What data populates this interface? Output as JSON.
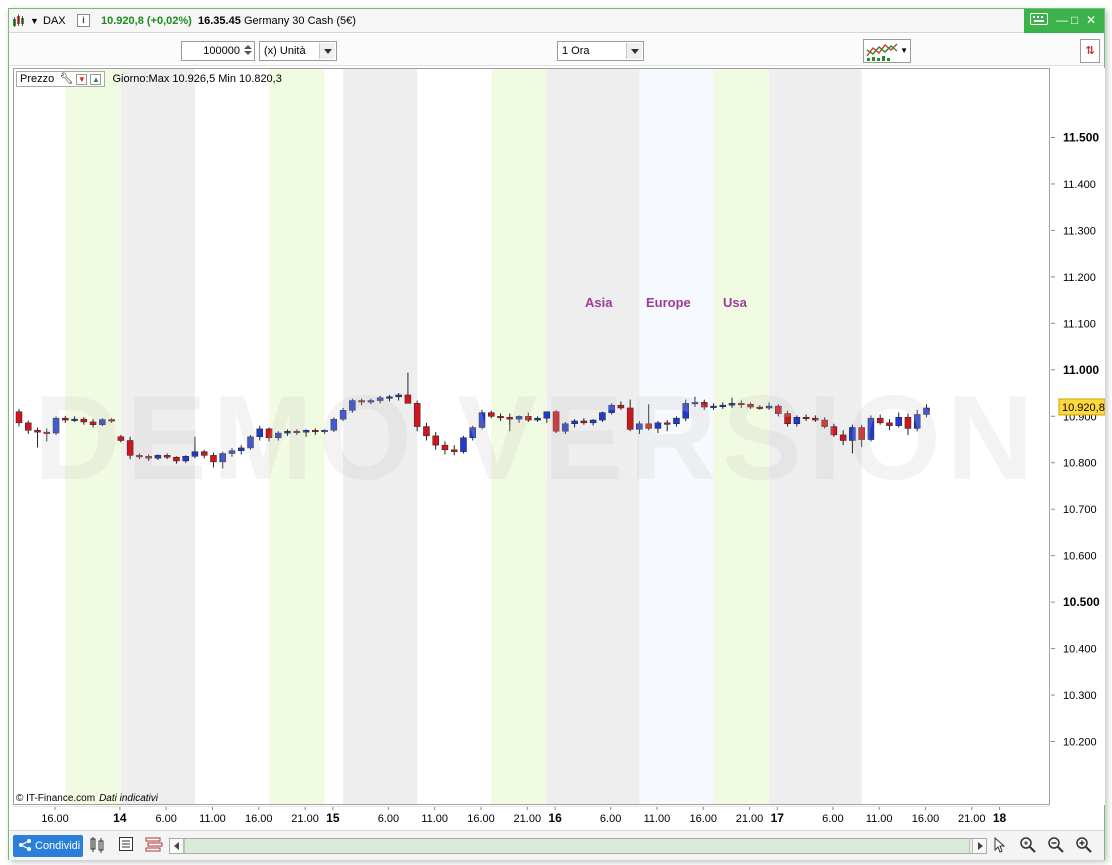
{
  "title_bar": {
    "symbol": "DAX",
    "info_icon": "i",
    "last_price": "10.920,8 (+0,02%)",
    "time": "16.35.45",
    "instrument": "Germany 30 Cash (5€)",
    "accent_color": "#3cb34a"
  },
  "toolbar": {
    "quantity": "100000",
    "unit_select": "(x) Unità",
    "timeframe_select": "1 Ora"
  },
  "chart": {
    "legend_label": "Prezzo",
    "legend_info": "Giorno:Max 10.926,5 Min 10.820,3",
    "watermark": "DEMO VERSION",
    "credit": "© IT-Finance.com",
    "credit_note": "Dati indicativi",
    "session_labels": [
      "Asia",
      "Europe",
      "Usa"
    ],
    "session_label_color": "#9b3c9b",
    "up_color": "#1f3bcf",
    "down_color": "#d0161c",
    "current_price_label": "10.920,8"
  },
  "chart_data": {
    "type": "candlestick",
    "ylim": [
      10100,
      11600
    ],
    "y_ticks": [
      {
        "value": 11500,
        "label": "11.500",
        "bold": true
      },
      {
        "value": 11400,
        "label": "11.400",
        "bold": false
      },
      {
        "value": 11300,
        "label": "11.300",
        "bold": false
      },
      {
        "value": 11200,
        "label": "11.200",
        "bold": false
      },
      {
        "value": 11100,
        "label": "11.100",
        "bold": false
      },
      {
        "value": 11000,
        "label": "11.000",
        "bold": true
      },
      {
        "value": 10900,
        "label": "10.900",
        "bold": false
      },
      {
        "value": 10800,
        "label": "10.800",
        "bold": false
      },
      {
        "value": 10700,
        "label": "10.700",
        "bold": false
      },
      {
        "value": 10600,
        "label": "10.600",
        "bold": false
      },
      {
        "value": 10500,
        "label": "10.500",
        "bold": true
      },
      {
        "value": 10400,
        "label": "10.400",
        "bold": false
      },
      {
        "value": 10300,
        "label": "10.300",
        "bold": false
      },
      {
        "value": 10200,
        "label": "10.200",
        "bold": false
      }
    ],
    "x_ticks": [
      {
        "bar": 4,
        "label": "16.00",
        "bold": false
      },
      {
        "bar": 11,
        "label": "14",
        "bold": true
      },
      {
        "bar": 16,
        "label": "6.00",
        "bold": false
      },
      {
        "bar": 21,
        "label": "11.00",
        "bold": false
      },
      {
        "bar": 26,
        "label": "16.00",
        "bold": false
      },
      {
        "bar": 31,
        "label": "21.00",
        "bold": false
      },
      {
        "bar": 34,
        "label": "15",
        "bold": true
      },
      {
        "bar": 40,
        "label": "6.00",
        "bold": false
      },
      {
        "bar": 45,
        "label": "11.00",
        "bold": false
      },
      {
        "bar": 50,
        "label": "16.00",
        "bold": false
      },
      {
        "bar": 55,
        "label": "21.00",
        "bold": false
      },
      {
        "bar": 58,
        "label": "16",
        "bold": true
      },
      {
        "bar": 64,
        "label": "6.00",
        "bold": false
      },
      {
        "bar": 69,
        "label": "11.00",
        "bold": false
      },
      {
        "bar": 74,
        "label": "16.00",
        "bold": false
      },
      {
        "bar": 79,
        "label": "21.00",
        "bold": false
      },
      {
        "bar": 82,
        "label": "17",
        "bold": true
      },
      {
        "bar": 88,
        "label": "6.00",
        "bold": false
      },
      {
        "bar": 93,
        "label": "11.00",
        "bold": false
      },
      {
        "bar": 98,
        "label": "16.00",
        "bold": false
      },
      {
        "bar": 103,
        "label": "21.00",
        "bold": false
      },
      {
        "bar": 106,
        "label": "18",
        "bold": true
      }
    ],
    "sessions": [
      {
        "name": "Asia",
        "from": 11,
        "to": 19,
        "color": "#eeeeee"
      },
      {
        "name": "Europe",
        "from": 5,
        "to": 11,
        "color": "#f1fbe2"
      },
      {
        "name": "Asia",
        "from": 35,
        "to": 43,
        "color": "#eeeeee"
      },
      {
        "name": "Europe",
        "from": 27,
        "to": 33,
        "color": "#f1fbe2"
      },
      {
        "name": "Europe",
        "from": 51,
        "to": 57,
        "color": "#f1fbe2"
      },
      {
        "name": "Asia",
        "from": 57,
        "to": 67,
        "color": "#eeeeee"
      },
      {
        "name": "Europe",
        "from": 67,
        "to": 75,
        "color": "#f6f9fd"
      },
      {
        "name": "Usa",
        "from": 75,
        "to": 81,
        "color": "#f1fbe2"
      },
      {
        "name": "Asia",
        "from": 81,
        "to": 91,
        "color": "#eeeeee"
      }
    ],
    "candles": [
      [
        10912,
        10918,
        10880,
        10888
      ],
      [
        10888,
        10893,
        10864,
        10872
      ],
      [
        10872,
        10878,
        10835,
        10868
      ],
      [
        10868,
        10876,
        10848,
        10866
      ],
      [
        10866,
        10902,
        10862,
        10898
      ],
      [
        10898,
        10903,
        10888,
        10894
      ],
      [
        10894,
        10902,
        10890,
        10896
      ],
      [
        10896,
        10900,
        10884,
        10890
      ],
      [
        10890,
        10896,
        10878,
        10884
      ],
      [
        10884,
        10898,
        10881,
        10895
      ],
      [
        10895,
        10898,
        10888,
        10892
      ],
      [
        10858,
        10862,
        10846,
        10850
      ],
      [
        10850,
        10858,
        10810,
        10818
      ],
      [
        10818,
        10822,
        10810,
        10816
      ],
      [
        10816,
        10820,
        10806,
        10812
      ],
      [
        10812,
        10820,
        10808,
        10818
      ],
      [
        10818,
        10822,
        10810,
        10814
      ],
      [
        10814,
        10816,
        10800,
        10806
      ],
      [
        10806,
        10818,
        10802,
        10816
      ],
      [
        10816,
        10858,
        10812,
        10826
      ],
      [
        10826,
        10830,
        10812,
        10818
      ],
      [
        10818,
        10824,
        10792,
        10804
      ],
      [
        10804,
        10826,
        10790,
        10822
      ],
      [
        10822,
        10834,
        10815,
        10828
      ],
      [
        10828,
        10840,
        10820,
        10834
      ],
      [
        10834,
        10862,
        10830,
        10858
      ],
      [
        10858,
        10882,
        10850,
        10875
      ],
      [
        10875,
        10878,
        10848,
        10856
      ],
      [
        10856,
        10870,
        10850,
        10866
      ],
      [
        10866,
        10874,
        10860,
        10870
      ],
      [
        10870,
        10874,
        10862,
        10868
      ],
      [
        10868,
        10874,
        10858,
        10872
      ],
      [
        10872,
        10876,
        10862,
        10870
      ],
      [
        10870,
        10874,
        10864,
        10872
      ],
      [
        10872,
        10900,
        10868,
        10896
      ],
      [
        10896,
        10920,
        10892,
        10915
      ],
      [
        10915,
        10940,
        10910,
        10936
      ],
      [
        10936,
        10940,
        10926,
        10934
      ],
      [
        10934,
        10940,
        10928,
        10936
      ],
      [
        10936,
        10946,
        10930,
        10942
      ],
      [
        10942,
        10948,
        10934,
        10944
      ],
      [
        10944,
        10952,
        10936,
        10948
      ],
      [
        10948,
        10996,
        10930,
        10930
      ],
      [
        10930,
        10936,
        10870,
        10880
      ],
      [
        10880,
        10888,
        10850,
        10860
      ],
      [
        10860,
        10868,
        10830,
        10840
      ],
      [
        10840,
        10848,
        10820,
        10830
      ],
      [
        10830,
        10840,
        10818,
        10826
      ],
      [
        10826,
        10860,
        10822,
        10856
      ],
      [
        10856,
        10882,
        10850,
        10878
      ],
      [
        10878,
        10916,
        10874,
        10910
      ],
      [
        10910,
        10914,
        10898,
        10902
      ],
      [
        10902,
        10908,
        10892,
        10900
      ],
      [
        10900,
        10908,
        10870,
        10896
      ],
      [
        10896,
        10904,
        10888,
        10902
      ],
      [
        10902,
        10910,
        10890,
        10894
      ],
      [
        10894,
        10902,
        10890,
        10898
      ],
      [
        10898,
        10910,
        10888,
        10912
      ],
      [
        10912,
        10915,
        10866,
        10870
      ],
      [
        10870,
        10890,
        10864,
        10886
      ],
      [
        10886,
        10896,
        10878,
        10892
      ],
      [
        10892,
        10898,
        10884,
        10888
      ],
      [
        10888,
        10896,
        10882,
        10894
      ],
      [
        10894,
        10912,
        10890,
        10910
      ],
      [
        10910,
        10930,
        10906,
        10926
      ],
      [
        10926,
        10934,
        10916,
        10920
      ],
      [
        10920,
        10938,
        10870,
        10874
      ],
      [
        10874,
        10892,
        10864,
        10886
      ],
      [
        10886,
        10928,
        10872,
        10876
      ],
      [
        10876,
        10892,
        10866,
        10888
      ],
      [
        10888,
        10894,
        10870,
        10886
      ],
      [
        10886,
        10902,
        10880,
        10898
      ],
      [
        10898,
        10938,
        10892,
        10930
      ],
      [
        10930,
        10944,
        10922,
        10932
      ],
      [
        10932,
        10938,
        10916,
        10922
      ],
      [
        10922,
        10930,
        10916,
        10924
      ],
      [
        10924,
        10932,
        10918,
        10926
      ],
      [
        10926,
        10942,
        10920,
        10930
      ],
      [
        10930,
        10936,
        10920,
        10928
      ],
      [
        10928,
        10932,
        10918,
        10922
      ],
      [
        10922,
        10926,
        10916,
        10920
      ],
      [
        10920,
        10932,
        10916,
        10924
      ],
      [
        10924,
        10928,
        10902,
        10908
      ],
      [
        10908,
        10914,
        10880,
        10886
      ],
      [
        10886,
        10904,
        10880,
        10900
      ],
      [
        10900,
        10906,
        10892,
        10898
      ],
      [
        10898,
        10904,
        10890,
        10894
      ],
      [
        10894,
        10900,
        10876,
        10880
      ],
      [
        10880,
        10886,
        10858,
        10862
      ],
      [
        10862,
        10872,
        10840,
        10850
      ],
      [
        10850,
        10884,
        10822,
        10878
      ],
      [
        10878,
        10884,
        10836,
        10852
      ],
      [
        10852,
        10904,
        10848,
        10898
      ],
      [
        10898,
        10906,
        10884,
        10888
      ],
      [
        10888,
        10896,
        10872,
        10882
      ],
      [
        10882,
        10910,
        10878,
        10900
      ],
      [
        10900,
        10908,
        10862,
        10876
      ],
      [
        10876,
        10916,
        10870,
        10906
      ],
      [
        10906,
        10928,
        10900,
        10920
      ]
    ]
  },
  "bottom_bar": {
    "share_label": "Condividi"
  }
}
